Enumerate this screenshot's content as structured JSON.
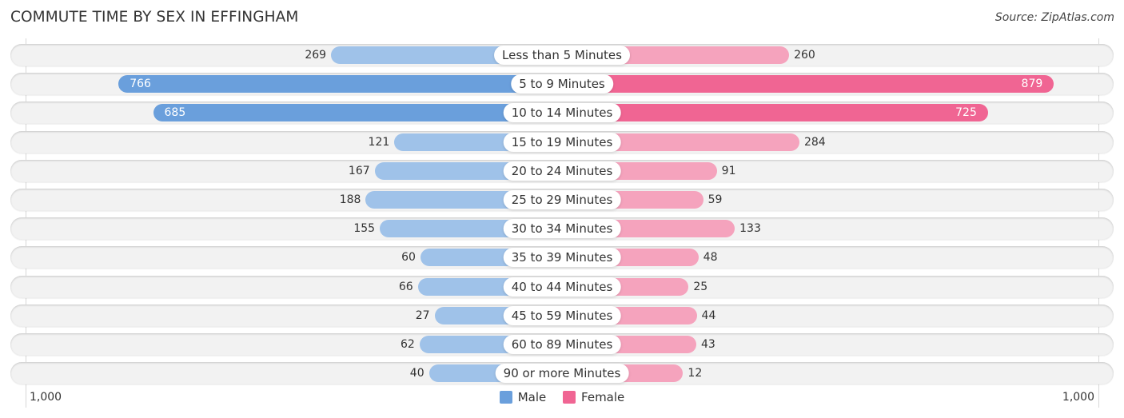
{
  "header": {
    "title": "COMMUTE TIME BY SEX IN EFFINGHAM",
    "source": "Source: ZipAtlas.com"
  },
  "colors": {
    "male_strong": "#6a9fdc",
    "male_light": "#9fc2e9",
    "female_strong": "#f06593",
    "female_light": "#f5a3bd"
  },
  "chart_data": {
    "type": "bar",
    "orientation": "horizontal-diverging",
    "title": "COMMUTE TIME BY SEX IN EFFINGHAM",
    "categories": [
      "Less than 5 Minutes",
      "5 to 9 Minutes",
      "10 to 14 Minutes",
      "15 to 19 Minutes",
      "20 to 24 Minutes",
      "25 to 29 Minutes",
      "30 to 34 Minutes",
      "35 to 39 Minutes",
      "40 to 44 Minutes",
      "45 to 59 Minutes",
      "60 to 89 Minutes",
      "90 or more Minutes"
    ],
    "series": [
      {
        "name": "Male",
        "values": [
          269,
          766,
          685,
          121,
          167,
          188,
          155,
          60,
          66,
          27,
          62,
          40
        ]
      },
      {
        "name": "Female",
        "values": [
          260,
          879,
          725,
          284,
          91,
          59,
          133,
          48,
          25,
          44,
          43,
          12
        ]
      }
    ],
    "axis": {
      "left_label": "1,000",
      "right_label": "1,000",
      "range": [
        -1000,
        1000
      ]
    },
    "legend": {
      "position": "bottom-center",
      "entries": [
        "Male",
        "Female"
      ]
    },
    "grid": false
  }
}
